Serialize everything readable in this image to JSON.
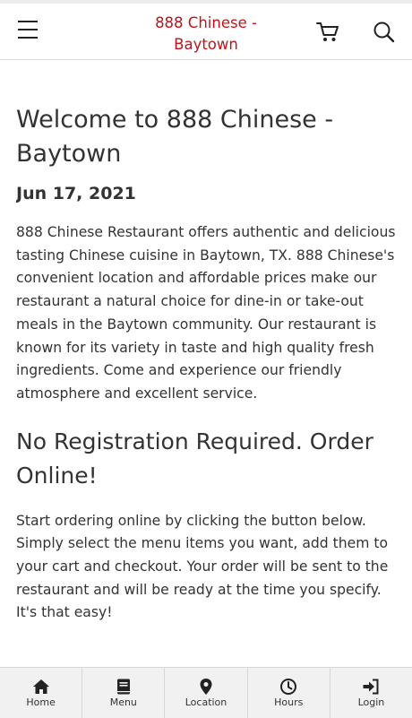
{
  "header": {
    "brand_line1": "888 Chinese -",
    "brand_line2": "Baytown",
    "menu_icon": "hamburger-menu-icon",
    "cart_icon": "shopping-cart-icon",
    "search_icon": "search-icon",
    "brand_color": "#c0141b"
  },
  "content": {
    "welcome_title": "Welcome to 888 Chinese - Baytown",
    "date": "Jun 17, 2021",
    "intro": "888 Chinese Restaurant offers authentic and delicious tasting Chinese cuisine in Baytown, TX.  888 Chinese's convenient location and affordable prices make our restaurant a natural choice for dine-in or take-out meals in the Baytown community. Our restaurant is known for its variety in taste and high quality fresh ingredients. Come and experience our friendly atmosphere and excellent service.",
    "order_title": "No Registration Required. Order Online!",
    "order_text": "Start ordering online by clicking the button below. Simply select the menu items you want, add them to your cart and checkout. Your order will be sent to the restaurant and will be ready at the time you specify. It's that easy!"
  },
  "bottom_nav": [
    {
      "label": "Home",
      "icon": "home-icon"
    },
    {
      "label": "Menu",
      "icon": "book-icon"
    },
    {
      "label": "Location",
      "icon": "map-pin-icon"
    },
    {
      "label": "Hours",
      "icon": "clock-icon"
    },
    {
      "label": "Login",
      "icon": "sign-in-icon"
    }
  ]
}
